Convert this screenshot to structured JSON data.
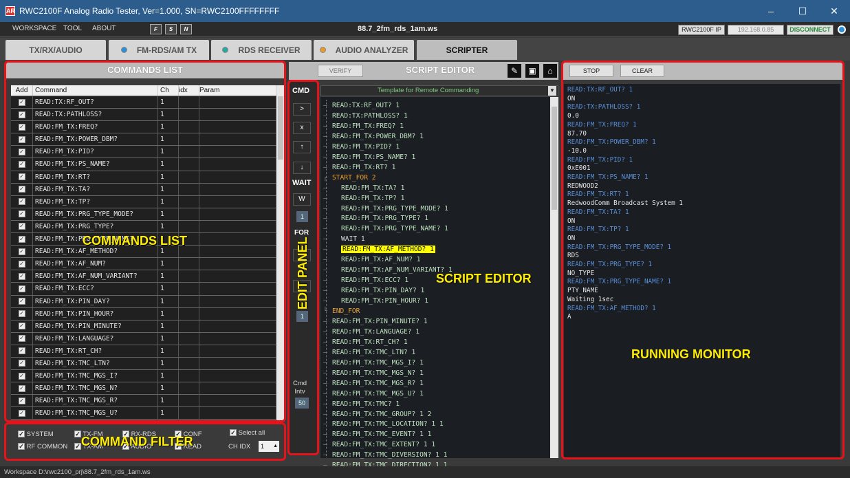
{
  "window": {
    "title": "RWC2100F Analog Radio Tester, Ver=1.000, SN=RWC2100FFFFFFFF",
    "minimize": "–",
    "maximize": "☐",
    "close": "✕",
    "app_icon": "AR"
  },
  "menu": {
    "items": [
      "WORKSPACE",
      "TOOL",
      "ABOUT"
    ],
    "file_title": "88.7_2fm_rds_1am.ws",
    "ip_label": "RWC2100F IP",
    "ip_value": "192.168.0.85",
    "disconnect": "DISCONNECT"
  },
  "toolbar_icons": [
    "F",
    "S",
    "N"
  ],
  "tabs": [
    {
      "label": "TX/RX/AUDIO",
      "dot": ""
    },
    {
      "label": "FM-RDS/AM TX",
      "dot": "#2a8fd6"
    },
    {
      "label": "RDS RECEIVER",
      "dot": "#2aa8a0"
    },
    {
      "label": "AUDIO ANALYZER",
      "dot": "#e89a2a"
    },
    {
      "label": "SCRIPTER",
      "dot": ""
    }
  ],
  "commands_panel": {
    "title": "COMMANDS LIST",
    "headers": {
      "add": "Add",
      "command": "Command",
      "ch": "Ch",
      "idx": "idx",
      "param": "Param"
    },
    "rows": [
      {
        "command": "READ:TX:RF_OUT?",
        "ch": "1"
      },
      {
        "command": "READ:TX:PATHLOSS?",
        "ch": "1"
      },
      {
        "command": "READ:FM_TX:FREQ?",
        "ch": "1"
      },
      {
        "command": "READ:FM_TX:POWER_DBM?",
        "ch": "1"
      },
      {
        "command": "READ:FM_TX:PID?",
        "ch": "1"
      },
      {
        "command": "READ:FM_TX:PS_NAME?",
        "ch": "1"
      },
      {
        "command": "READ:FM_TX:RT?",
        "ch": "1"
      },
      {
        "command": "READ:FM_TX:TA?",
        "ch": "1"
      },
      {
        "command": "READ:FM_TX:TP?",
        "ch": "1"
      },
      {
        "command": "READ:FM_TX:PRG_TYPE_MODE?",
        "ch": "1"
      },
      {
        "command": "READ:FM_TX:PRG_TYPE?",
        "ch": "1"
      },
      {
        "command": "READ:FM_TX:PRG_TYPE_NAME?",
        "ch": "1"
      },
      {
        "command": "READ:FM_TX:AF_METHOD?",
        "ch": "1"
      },
      {
        "command": "READ:FM_TX:AF_NUM?",
        "ch": "1"
      },
      {
        "command": "READ:FM_TX:AF_NUM_VARIANT?",
        "ch": "1"
      },
      {
        "command": "READ:FM_TX:ECC?",
        "ch": "1"
      },
      {
        "command": "READ:FM_TX:PIN_DAY?",
        "ch": "1"
      },
      {
        "command": "READ:FM_TX:PIN_HOUR?",
        "ch": "1"
      },
      {
        "command": "READ:FM_TX:PIN_MINUTE?",
        "ch": "1"
      },
      {
        "command": "READ:FM_TX:LANGUAGE?",
        "ch": "1"
      },
      {
        "command": "READ:FM_TX:RT_CH?",
        "ch": "1"
      },
      {
        "command": "READ:FM_TX:TMC_LTN?",
        "ch": "1"
      },
      {
        "command": "READ:FM_TX:TMC_MGS_I?",
        "ch": "1"
      },
      {
        "command": "READ:FM_TX:TMC_MGS_N?",
        "ch": "1"
      },
      {
        "command": "READ:FM_TX:TMC_MGS_R?",
        "ch": "1"
      },
      {
        "command": "READ:FM_TX:TMC_MGS_U?",
        "ch": "1"
      }
    ]
  },
  "filter": {
    "items": [
      "SYSTEM",
      "TX-FM",
      "RX-RDS",
      "CONF",
      "RF COMMON",
      "TX-AM",
      "AUDIO",
      "READ"
    ],
    "select_all": "Select all",
    "ch_idx_label": "CH IDX",
    "ch_idx_value": "1"
  },
  "edit_panel": {
    "cmd_label": "CMD",
    "buttons": [
      ">",
      "x",
      "↑",
      "↓"
    ],
    "wait_label": "WAIT",
    "wait_button": "W",
    "wait_value": "1",
    "for_label": "FOR",
    "for_value": "1",
    "intv_label": "Cmd\nIntv",
    "intv_value": "50"
  },
  "script_editor": {
    "title": "SCRIPT EDITOR",
    "verify": "VERIFY",
    "template": "Template for Remote Commanding",
    "lines": [
      {
        "text": "READ:TX:RF_OUT? 1",
        "indent": 0,
        "kind": "cmd"
      },
      {
        "text": "READ:TX:PATHLOSS? 1",
        "indent": 0,
        "kind": "cmd"
      },
      {
        "text": "READ:FM_TX:FREQ? 1",
        "indent": 0,
        "kind": "cmd"
      },
      {
        "text": "READ:FM_TX:POWER_DBM? 1",
        "indent": 0,
        "kind": "cmd"
      },
      {
        "text": "READ:FM_TX:PID? 1",
        "indent": 0,
        "kind": "cmd"
      },
      {
        "text": "READ:FM_TX:PS_NAME? 1",
        "indent": 0,
        "kind": "cmd"
      },
      {
        "text": "READ:FM_TX:RT? 1",
        "indent": 0,
        "kind": "cmd"
      },
      {
        "text": "START_FOR 2",
        "indent": 0,
        "kind": "for"
      },
      {
        "text": "READ:FM_TX:TA? 1",
        "indent": 1,
        "kind": "cmd"
      },
      {
        "text": "READ:FM_TX:TP? 1",
        "indent": 1,
        "kind": "cmd"
      },
      {
        "text": "READ:FM_TX:PRG_TYPE_MODE? 1",
        "indent": 1,
        "kind": "cmd"
      },
      {
        "text": "READ:FM_TX:PRG_TYPE? 1",
        "indent": 1,
        "kind": "cmd"
      },
      {
        "text": "READ:FM_TX:PRG_TYPE_NAME? 1",
        "indent": 1,
        "kind": "cmd"
      },
      {
        "text": "WAIT 1",
        "indent": 1,
        "kind": "wait"
      },
      {
        "text": "READ:FM_TX:AF_METHOD? 1",
        "indent": 1,
        "kind": "hl"
      },
      {
        "text": "READ:FM_TX:AF_NUM? 1",
        "indent": 1,
        "kind": "cmd"
      },
      {
        "text": "READ:FM_TX:AF_NUM_VARIANT? 1",
        "indent": 1,
        "kind": "cmd"
      },
      {
        "text": "READ:FM_TX:ECC? 1",
        "indent": 1,
        "kind": "cmd"
      },
      {
        "text": "READ:FM_TX:PIN_DAY? 1",
        "indent": 1,
        "kind": "cmd"
      },
      {
        "text": "READ:FM_TX:PIN_HOUR? 1",
        "indent": 1,
        "kind": "cmd"
      },
      {
        "text": "END_FOR",
        "indent": 0,
        "kind": "for"
      },
      {
        "text": "READ:FM_TX:PIN_MINUTE? 1",
        "indent": 0,
        "kind": "cmd"
      },
      {
        "text": "READ:FM_TX:LANGUAGE? 1",
        "indent": 0,
        "kind": "cmd"
      },
      {
        "text": "READ:FM_TX:RT_CH? 1",
        "indent": 0,
        "kind": "cmd"
      },
      {
        "text": "READ:FM_TX:TMC_LTN? 1",
        "indent": 0,
        "kind": "cmd"
      },
      {
        "text": "READ:FM_TX:TMC_MGS_I? 1",
        "indent": 0,
        "kind": "cmd"
      },
      {
        "text": "READ:FM_TX:TMC_MGS_N? 1",
        "indent": 0,
        "kind": "cmd"
      },
      {
        "text": "READ:FM_TX:TMC_MGS_R? 1",
        "indent": 0,
        "kind": "cmd"
      },
      {
        "text": "READ:FM_TX:TMC_MGS_U? 1",
        "indent": 0,
        "kind": "cmd"
      },
      {
        "text": "READ:FM_TX:TMC? 1",
        "indent": 0,
        "kind": "cmd"
      },
      {
        "text": "READ:FM_TX:TMC_GROUP? 1 2",
        "indent": 0,
        "kind": "cmd"
      },
      {
        "text": "READ:FM_TX:TMC_LOCATION? 1 1",
        "indent": 0,
        "kind": "cmd"
      },
      {
        "text": "READ:FM_TX:TMC_EVENT? 1 1",
        "indent": 0,
        "kind": "cmd"
      },
      {
        "text": "READ:FM_TX:TMC_EXTENT? 1 1",
        "indent": 0,
        "kind": "cmd"
      },
      {
        "text": "READ:FM_TX:TMC_DIVERSION? 1 1",
        "indent": 0,
        "kind": "cmd"
      },
      {
        "text": "READ:FM_TX:TMC_DIRECTION? 1 1",
        "indent": 0,
        "kind": "cmd"
      }
    ]
  },
  "monitor": {
    "stop": "STOP",
    "clear": "CLEAR",
    "lines": [
      {
        "text": "READ:TX:RF_OUT? 1",
        "kind": "cmd"
      },
      {
        "text": "ON",
        "kind": "resp"
      },
      {
        "text": "READ:TX:PATHLOSS? 1",
        "kind": "cmd"
      },
      {
        "text": "0.0",
        "kind": "resp"
      },
      {
        "text": "READ:FM_TX:FREQ? 1",
        "kind": "cmd"
      },
      {
        "text": "87.70",
        "kind": "resp"
      },
      {
        "text": "READ:FM_TX:POWER_DBM? 1",
        "kind": "cmd"
      },
      {
        "text": "-10.0",
        "kind": "resp"
      },
      {
        "text": "READ:FM_TX:PID? 1",
        "kind": "cmd"
      },
      {
        "text": "0xE001",
        "kind": "resp"
      },
      {
        "text": "READ:FM_TX:PS_NAME? 1",
        "kind": "cmd"
      },
      {
        "text": "REDWOOD2",
        "kind": "resp"
      },
      {
        "text": "READ:FM_TX:RT? 1",
        "kind": "cmd"
      },
      {
        "text": "RedwoodComm Broadcast System 1",
        "kind": "resp"
      },
      {
        "text": "READ:FM_TX:TA? 1",
        "kind": "cmd"
      },
      {
        "text": "ON",
        "kind": "resp"
      },
      {
        "text": "READ:FM_TX:TP? 1",
        "kind": "cmd"
      },
      {
        "text": "ON",
        "kind": "resp"
      },
      {
        "text": "READ:FM_TX:PRG_TYPE_MODE? 1",
        "kind": "cmd"
      },
      {
        "text": "RDS",
        "kind": "resp"
      },
      {
        "text": "READ:FM_TX:PRG_TYPE? 1",
        "kind": "cmd"
      },
      {
        "text": "NO_TYPE",
        "kind": "resp"
      },
      {
        "text": "READ:FM_TX:PRG_TYPE_NAME? 1",
        "kind": "cmd"
      },
      {
        "text": "PTY_NAME",
        "kind": "resp"
      },
      {
        "text": "Waiting 1sec",
        "kind": "resp"
      },
      {
        "text": "READ:FM_TX:AF_METHOD? 1",
        "kind": "cmd"
      },
      {
        "text": "A",
        "kind": "resp"
      }
    ]
  },
  "annotations": {
    "commands_list": "COMMANDS LIST",
    "edit_panel": "EDIT PANEL",
    "script_editor": "SCRIPT  EDITOR",
    "running_monitor": "RUNNING MONITOR",
    "command_filter": "COMMAND FILTER"
  },
  "status": {
    "workspace": "Workspace  D:\\rwc2100_prj\\88.7_2fm_rds_1am.ws"
  },
  "colors": {
    "title_bar": "#2d5d8c",
    "highlight": "#ffff00",
    "annotation": "#ffee00",
    "annotation_border": "#e8121a",
    "monitor_cmd": "#5b8fd8",
    "script_for": "#e8a030"
  }
}
